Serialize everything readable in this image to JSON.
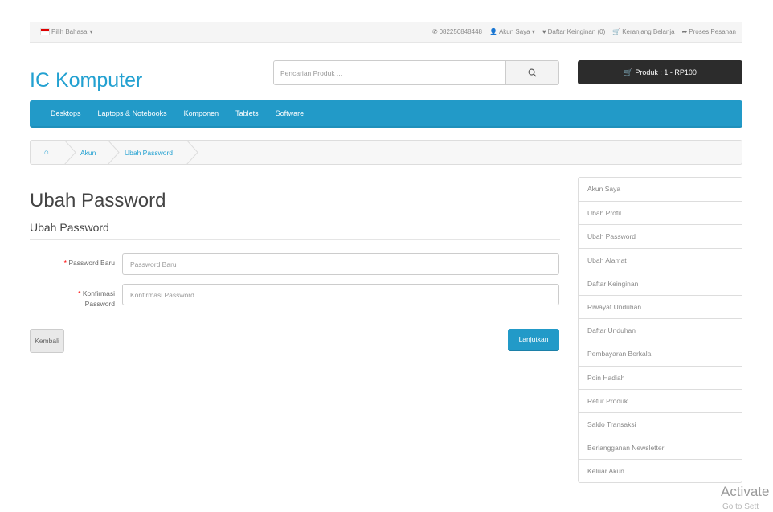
{
  "topbar": {
    "language": "Pilih Bahasa",
    "phone": "082250848448",
    "account": "Akun Saya",
    "wishlist": "Daftar Keinginan (0)",
    "cart": "Keranjang Belanja",
    "checkout": "Proses Pesanan"
  },
  "header": {
    "logo": "IC Komputer",
    "search_placeholder": "Pencarian Produk ...",
    "cart_summary": "Produk : 1 - RP100"
  },
  "nav": [
    "Desktops",
    "Laptops & Notebooks",
    "Komponen",
    "Tablets",
    "Software"
  ],
  "breadcrumb": {
    "home_icon": "home-icon",
    "items": [
      "Akun",
      "Ubah Password"
    ]
  },
  "main": {
    "title": "Ubah Password",
    "legend": "Ubah Password",
    "fields": [
      {
        "required": "*",
        "label": "Password Baru",
        "placeholder": "Password Baru"
      },
      {
        "required": "*",
        "label": "Konfirmasi Password",
        "placeholder": "Konfirmasi Password"
      }
    ],
    "back_button": "Kembali",
    "continue_button": "Lanjutkan"
  },
  "sidebar": [
    "Akun Saya",
    "Ubah Profil",
    "Ubah Password",
    "Ubah Alamat",
    "Daftar Keinginan",
    "Riwayat Unduhan",
    "Daftar Unduhan",
    "Pembayaran Berkala",
    "Poin Hadiah",
    "Retur Produk",
    "Saldo Transaksi",
    "Berlangganan Newsletter",
    "Keluar Akun"
  ],
  "watermark": {
    "title": "Activate",
    "subtitle": "Go to Sett"
  },
  "colors": {
    "brand": "#23a1d1",
    "nav": "#229ac8",
    "cart": "#2c2c2c"
  }
}
